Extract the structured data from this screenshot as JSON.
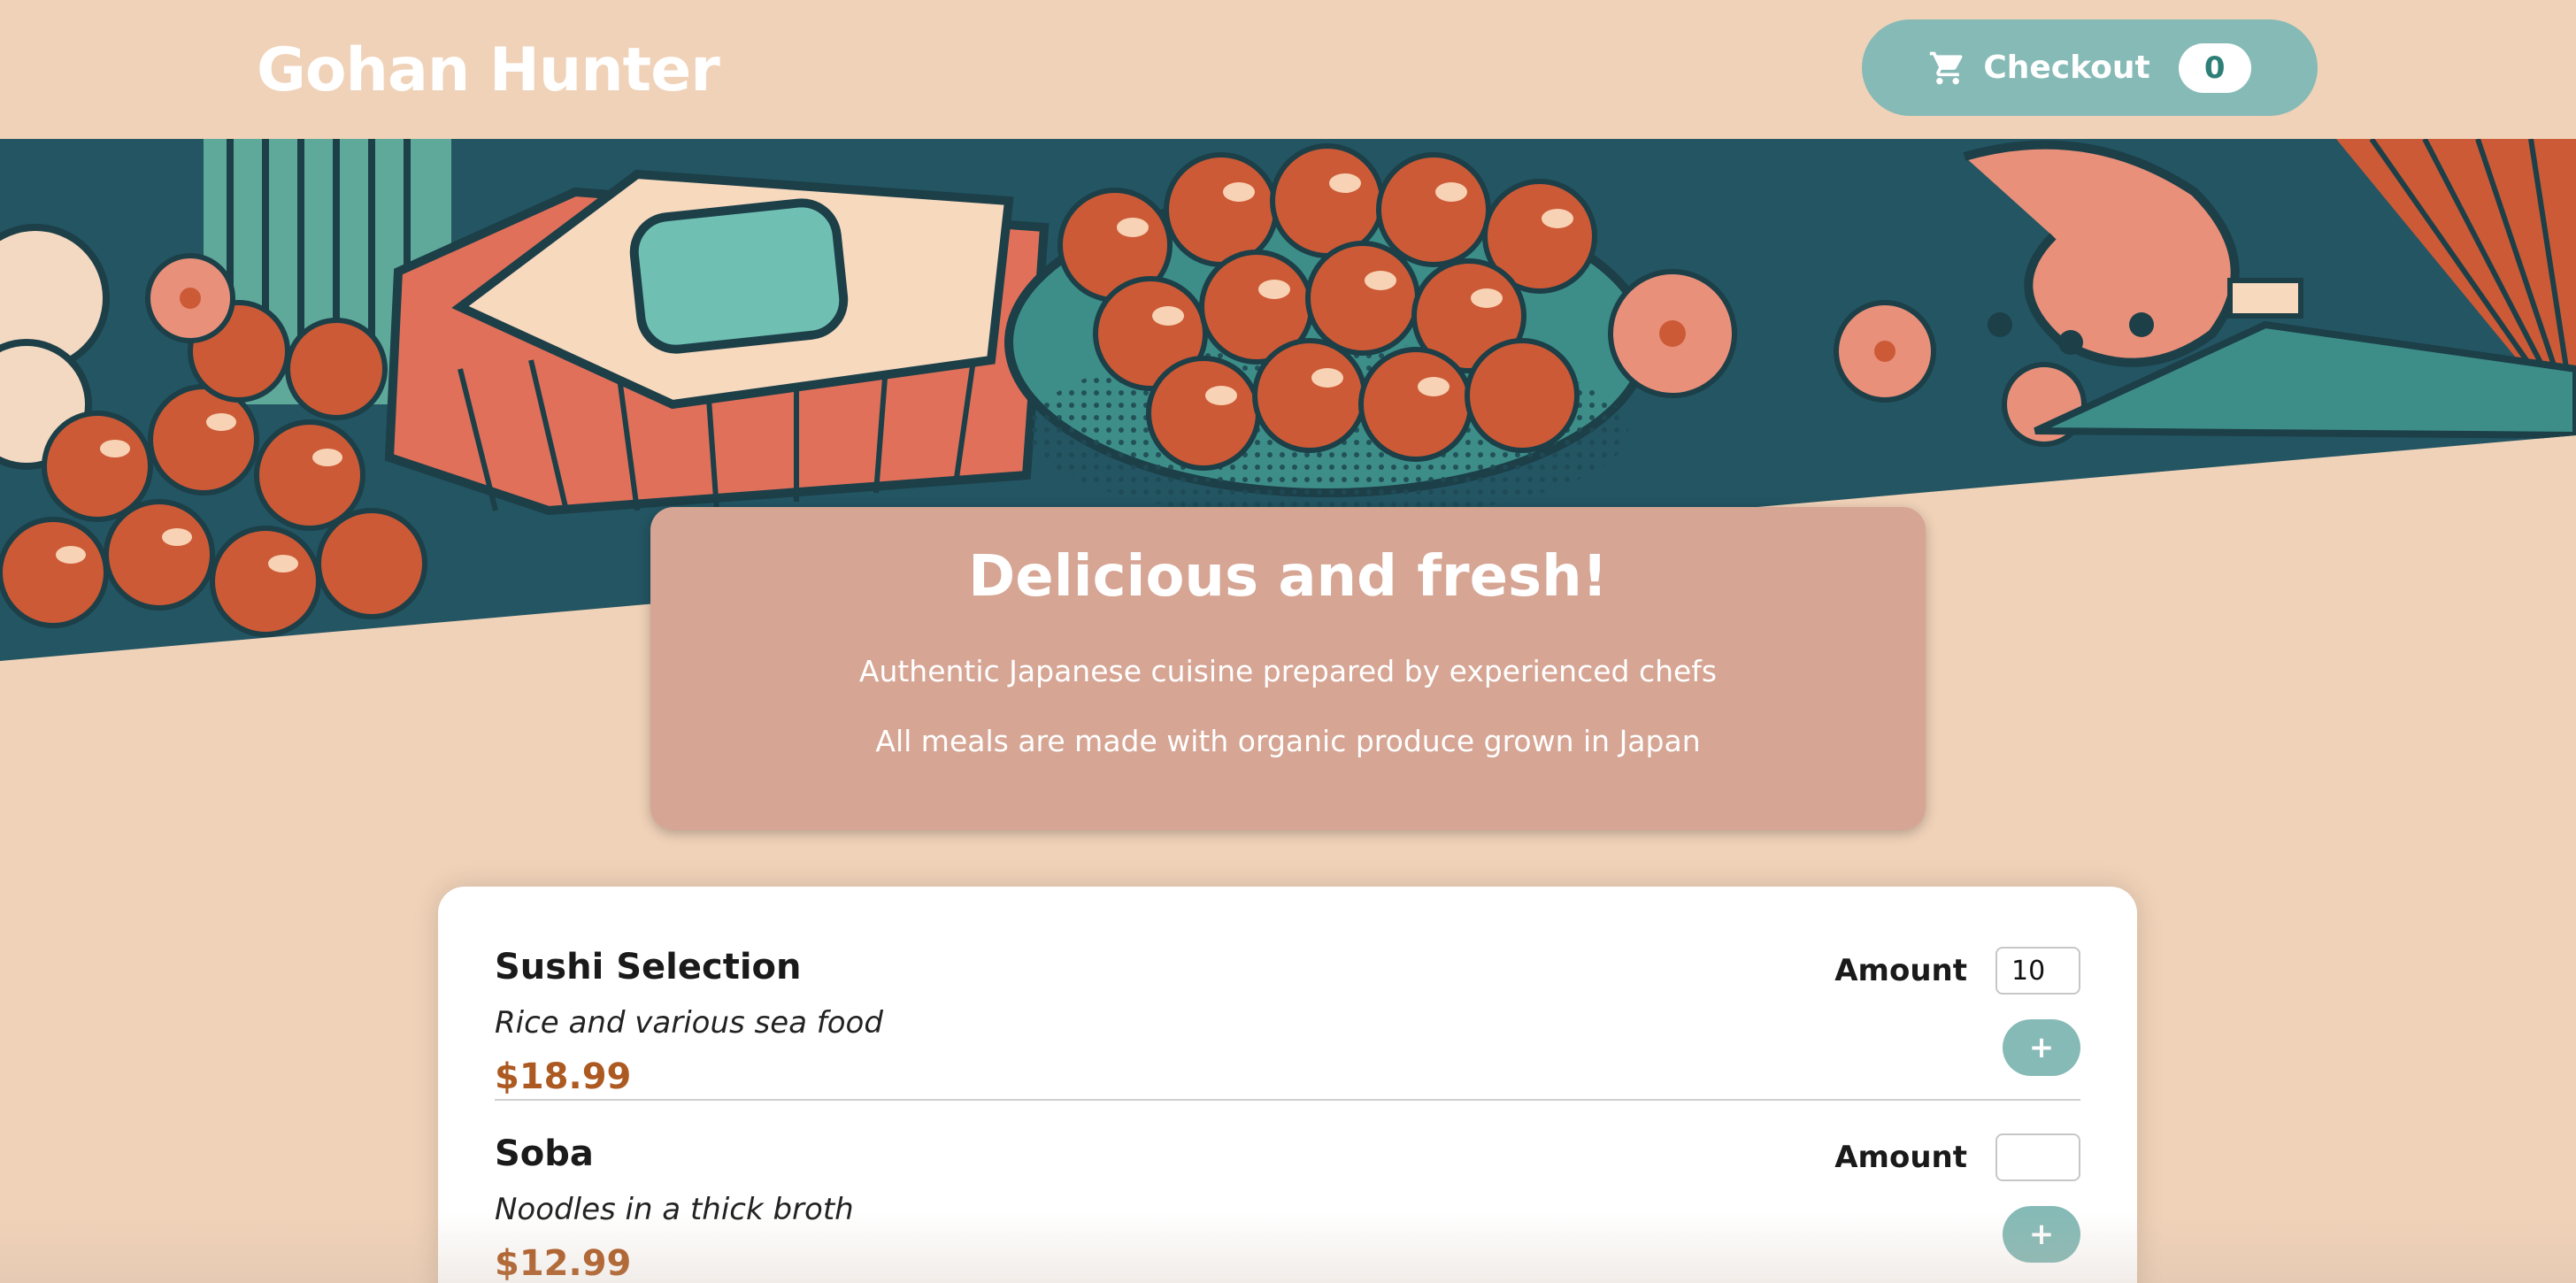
{
  "header": {
    "title": "Gohan Hunter",
    "checkout_label": "Checkout",
    "cart_count": "0"
  },
  "intro": {
    "heading": "Delicious and fresh!",
    "line1": "Authentic Japanese cuisine prepared by experienced chefs",
    "line2": "All meals are made with organic produce grown in Japan"
  },
  "meals": [
    {
      "name": "Sushi Selection",
      "description": "Rice and various sea food",
      "price": "$18.99",
      "amount_label": "Amount",
      "amount_value": "10",
      "add_label": "+"
    },
    {
      "name": "Soba",
      "description": "Noodles in a thick broth",
      "price": "$12.99",
      "amount_label": "Amount",
      "amount_value": "",
      "add_label": "+"
    }
  ],
  "colors": {
    "background": "#f0d2b8",
    "accent": "#86bab6",
    "intro_card": "#d6a594",
    "price": "#ad5a22"
  },
  "icons": {
    "checkout": "cart-icon"
  }
}
